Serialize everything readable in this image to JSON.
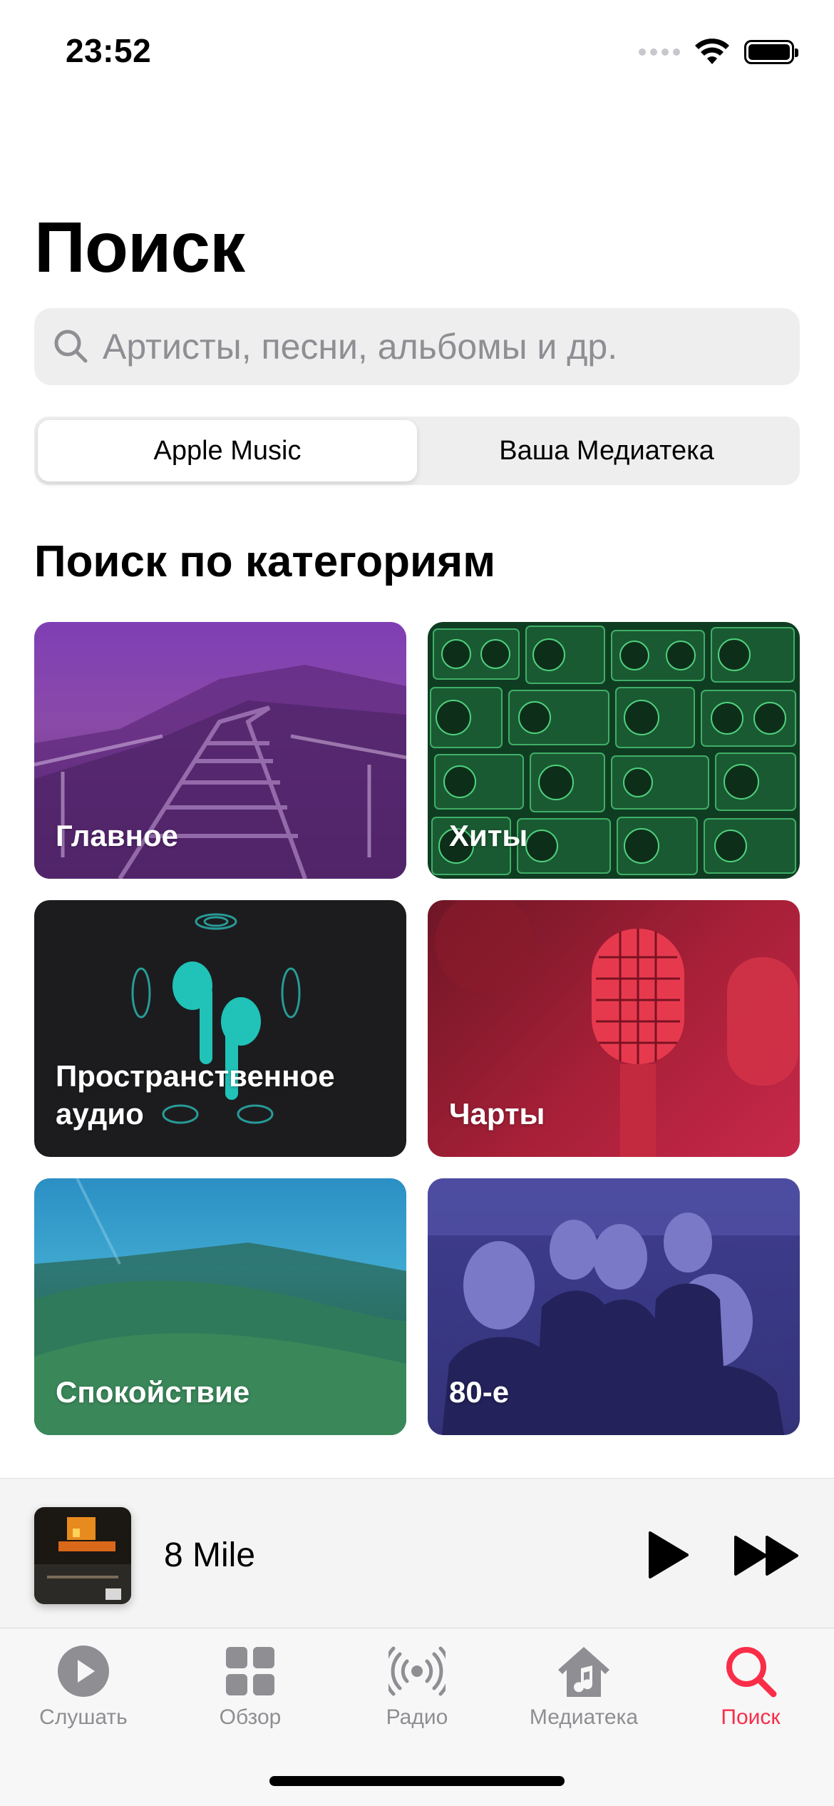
{
  "status": {
    "time": "23:52"
  },
  "title": "Поиск",
  "search": {
    "placeholder": "Артисты, песни, альбомы и др."
  },
  "segments": [
    {
      "label": "Apple Music",
      "active": true
    },
    {
      "label": "Ваша Медиатека",
      "active": false
    }
  ],
  "section_title": "Поиск по категориям",
  "categories": [
    {
      "label": "Главное",
      "color": "#7a3fa0"
    },
    {
      "label": "Хиты",
      "color": "#1f6b3a"
    },
    {
      "label": "Пространственное аудио",
      "color": "#1c1c1e"
    },
    {
      "label": "Чарты",
      "color": "#b0243a"
    },
    {
      "label": "Спокойствие",
      "color": "#1d6a7a"
    },
    {
      "label": "80-е",
      "color": "#3b3a8c"
    }
  ],
  "now_playing": {
    "title": "8 Mile"
  },
  "tabs": [
    {
      "label": "Слушать",
      "icon": "play-circle-icon"
    },
    {
      "label": "Обзор",
      "icon": "grid-icon"
    },
    {
      "label": "Радио",
      "icon": "radio-icon"
    },
    {
      "label": "Медиатека",
      "icon": "library-icon"
    },
    {
      "label": "Поиск",
      "icon": "search-icon",
      "active": true
    }
  ],
  "colors": {
    "accent": "#fa2d48",
    "tab_inactive": "#8e8e93"
  }
}
